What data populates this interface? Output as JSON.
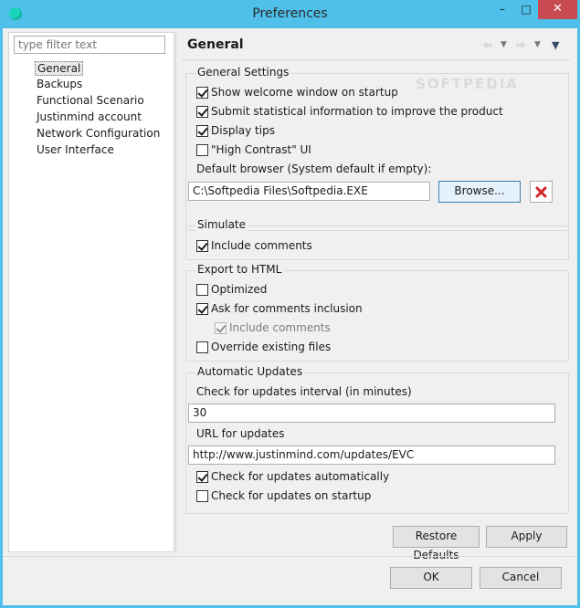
{
  "window": {
    "title": "Preferences",
    "controls": {
      "minimize": "–",
      "maximize": "□",
      "close": "✕"
    }
  },
  "sidebar": {
    "filter_placeholder": "type filter text",
    "items": [
      {
        "label": "General",
        "selected": true
      },
      {
        "label": "Backups"
      },
      {
        "label": "Functional Scenario"
      },
      {
        "label": "Justinmind account"
      },
      {
        "label": "Network Configuration"
      },
      {
        "label": "User Interface"
      }
    ]
  },
  "page": {
    "title": "General",
    "nav_icons": [
      "back-arrow-icon",
      "dropdown-icon",
      "forward-arrow-icon",
      "dropdown-icon",
      "view-menu-icon"
    ]
  },
  "watermark": "SOFTPEDIA",
  "general_settings": {
    "title": "General Settings",
    "show_welcome": {
      "label": "Show welcome window on startup",
      "checked": true
    },
    "submit_stats": {
      "label": "Submit statistical information to improve the product",
      "checked": true
    },
    "display_tips": {
      "label": "Display tips",
      "checked": true
    },
    "high_contrast": {
      "label": "\"High Contrast\" UI",
      "checked": false
    },
    "browser_label": "Default browser (System default if empty):",
    "browser_value": "C:\\Softpedia Files\\Softpedia.EXE",
    "browse_button": "Browse..."
  },
  "simulate": {
    "title": "Simulate",
    "include_comments": {
      "label": "Include comments",
      "checked": true
    }
  },
  "export_html": {
    "title": "Export to HTML",
    "optimized": {
      "label": "Optimized",
      "checked": false
    },
    "ask_comments": {
      "label": "Ask for comments inclusion",
      "checked": true
    },
    "include_comments": {
      "label": "Include comments",
      "checked": true,
      "disabled": true
    },
    "override_files": {
      "label": "Override existing files",
      "checked": false
    }
  },
  "automatic_updates": {
    "title": "Automatic Updates",
    "interval_label": "Check for updates interval (in minutes)",
    "interval_value": "30",
    "url_label": "URL for updates",
    "url_value": "http://www.justinmind.com/updates/EVC",
    "check_auto": {
      "label": "Check for updates automatically",
      "checked": true
    },
    "check_startup": {
      "label": "Check for updates on startup",
      "checked": false
    }
  },
  "actions": {
    "restore_defaults": "Restore Defaults",
    "apply": "Apply",
    "ok": "OK",
    "cancel": "Cancel"
  },
  "colors": {
    "titlebar": "#4fc0ea",
    "close_button": "#c74b50",
    "clear_icon": "#d4252b"
  }
}
